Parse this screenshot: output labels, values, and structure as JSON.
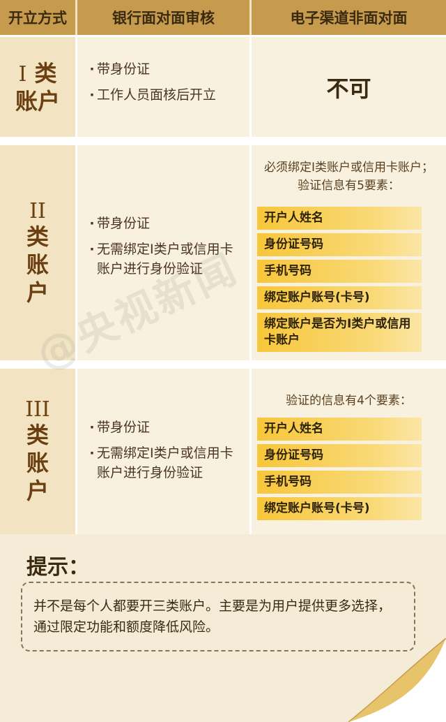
{
  "header": {
    "col1": "开立方式",
    "col2": "银行面对面审核",
    "col3": "电子渠道非面对面"
  },
  "rows": [
    {
      "roman": "I",
      "label_line1": "类",
      "label_line2": "账户",
      "bullets": [
        "带身份证",
        "工作人员面核后开立"
      ],
      "right_text": "不可"
    },
    {
      "roman": "II",
      "label_line1": "类",
      "label_line2": "账",
      "label_line3": "户",
      "bullets": [
        "带身份证",
        "无需绑定I类户或信用卡账户进行身份验证"
      ],
      "intro": "必须绑定I类账户或信用卡账户；验证信息有5要素：",
      "factors": [
        "开户人姓名",
        "身份证号码",
        "手机号码",
        "绑定账户账号(卡号)",
        "绑定账户是否为I类户或信用卡账户"
      ]
    },
    {
      "roman": "III",
      "label_line1": "类",
      "label_line2": "账",
      "label_line3": "户",
      "bullets": [
        "带身份证",
        "无需绑定I类户或信用卡账户进行身份验证"
      ],
      "intro": "验证的信息有4个要素：",
      "factors": [
        "开户人姓名",
        "身份证号码",
        "手机号码",
        "绑定账户账号(卡号)"
      ]
    }
  ],
  "tip": {
    "title": "提示：",
    "body": "并不是每个人都要开三类账户。主要是为用户提供更多选择，通过限定功能和额度降低风险。"
  },
  "watermark": "@央视新闻",
  "colors": {
    "header_bg": "#c79b4e",
    "label_bg": "#f2e4c2",
    "cell_bg": "#f8f1df",
    "factor_yellow": "#f7c63a",
    "label_text": "#6b3f12"
  }
}
